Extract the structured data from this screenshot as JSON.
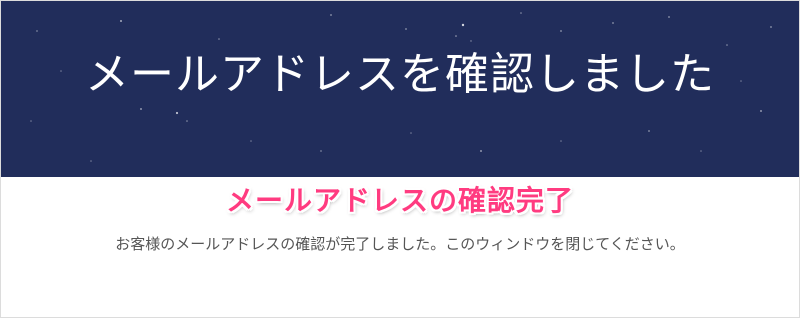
{
  "hero": {
    "title": "メールアドレスを確認しました",
    "background_color": "#212d5b"
  },
  "annotation": {
    "text": "メールアドレスの確認完了",
    "color": "#ff3b80"
  },
  "message": {
    "text": "お客様のメールアドレスの確認が完了しました。このウィンドウを閉じてください。"
  }
}
